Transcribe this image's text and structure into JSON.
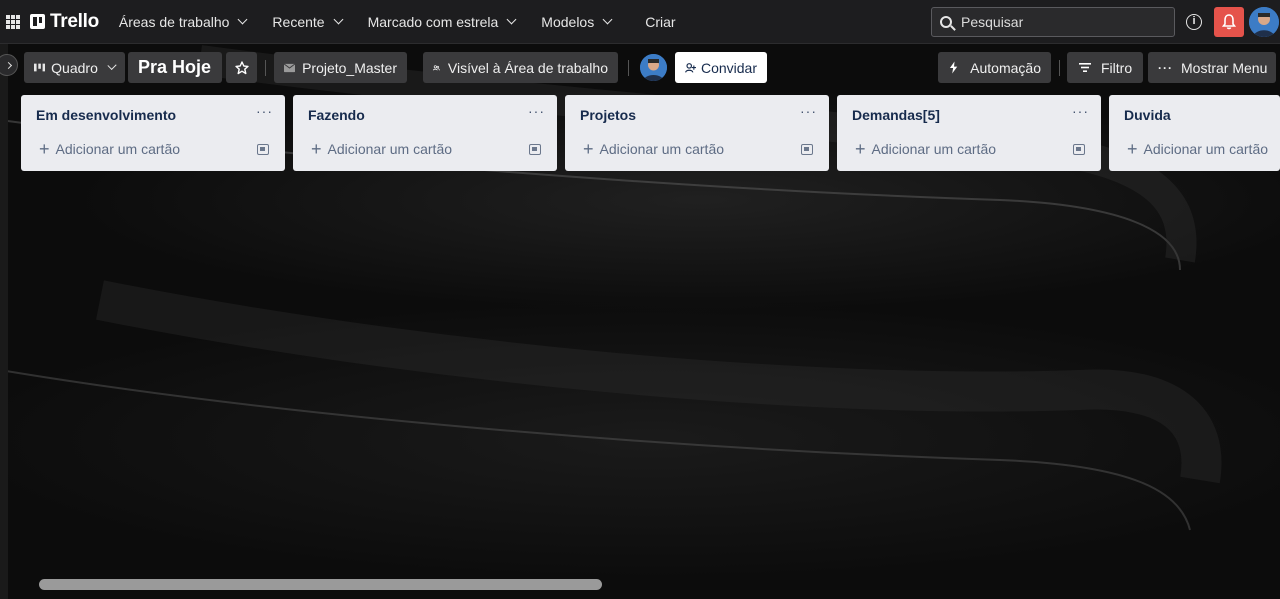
{
  "topnav": {
    "logo": "Trello",
    "items": [
      {
        "label": "Áreas de trabalho"
      },
      {
        "label": "Recente"
      },
      {
        "label": "Marcado com estrela"
      },
      {
        "label": "Modelos"
      }
    ],
    "create_label": "Criar",
    "search_placeholder": "Pesquisar",
    "info_glyph": "i"
  },
  "board": {
    "view_label": "Quadro",
    "title": "Pra Hoje",
    "workspace": "Projeto_Master",
    "visibility": "Visível à Área de trabalho",
    "invite_label": "Convidar",
    "automation_label": "Automação",
    "filter_label": "Filtro",
    "menu_label": "Mostrar Menu"
  },
  "lists": [
    {
      "title": "Em desenvolvimento",
      "add_label": "Adicionar um cartão"
    },
    {
      "title": "Fazendo",
      "add_label": "Adicionar um cartão"
    },
    {
      "title": "Projetos",
      "add_label": "Adicionar um cartão"
    },
    {
      "title": "Demandas[5]",
      "add_label": "Adicionar um cartão"
    },
    {
      "title": "Duvida",
      "add_label": "Adicionar um cartão"
    }
  ],
  "colors": {
    "nav_bg": "#1d1d1f",
    "button_bg": "#3a3a3c",
    "list_bg": "#ebecf0",
    "notification": "#e5534b"
  },
  "icons": [
    "apps-grid-icon",
    "trello-logo-icon",
    "search-icon",
    "info-icon",
    "bell-icon",
    "board-view-icon",
    "star-icon",
    "workspace-icon",
    "visibility-icon",
    "add-person-icon",
    "lightning-icon",
    "filter-icon",
    "more-icon",
    "plus-icon",
    "template-icon"
  ]
}
